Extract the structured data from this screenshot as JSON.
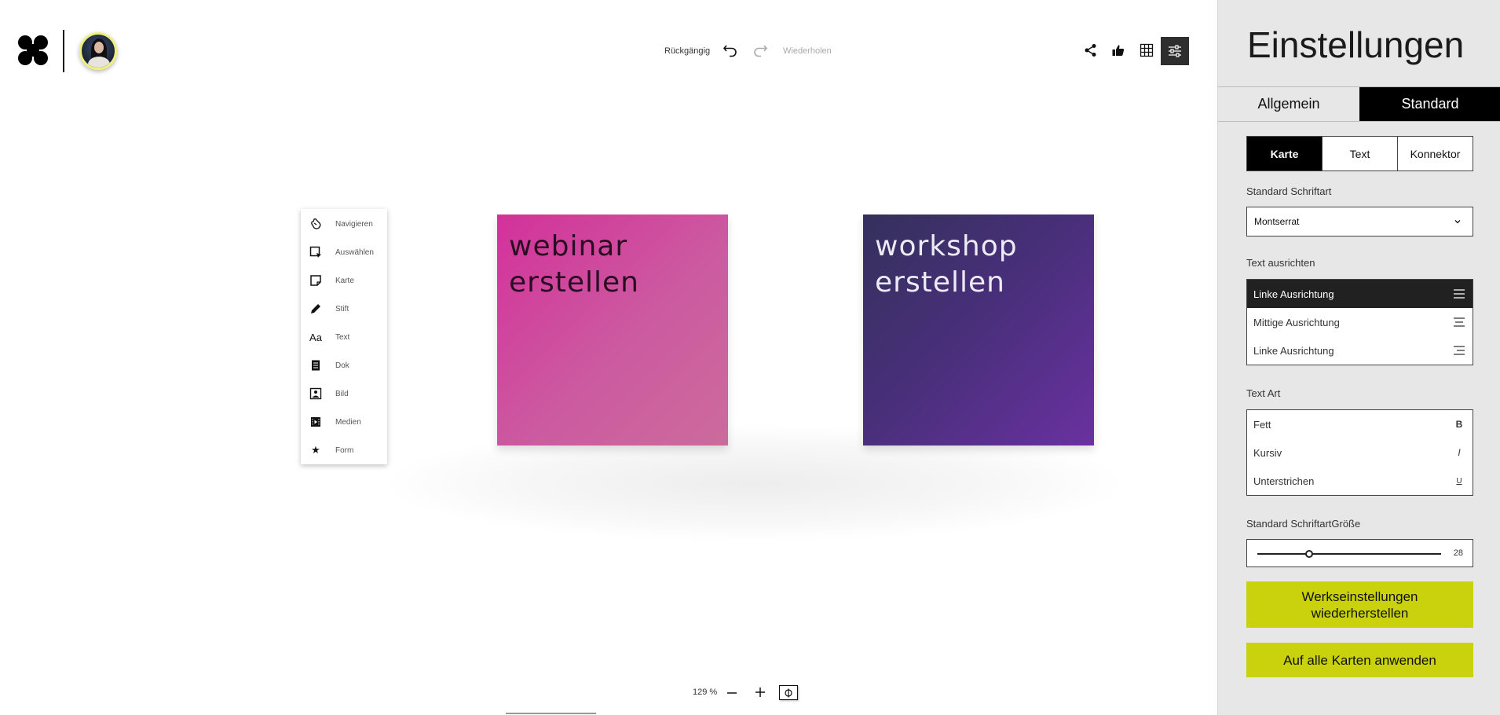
{
  "header": {
    "undo_label": "Rückgängig",
    "redo_label": "Wiederholen",
    "actions": [
      {
        "name": "share-icon"
      },
      {
        "name": "thumbs-up-icon"
      },
      {
        "name": "grid-icon"
      },
      {
        "name": "settings-sliders-icon"
      }
    ]
  },
  "toolbox": {
    "items": [
      {
        "label": "Navigieren",
        "icon": "navigate-hand-icon"
      },
      {
        "label": "Auswählen",
        "icon": "select-icon"
      },
      {
        "label": "Karte",
        "icon": "card-icon"
      },
      {
        "label": "Stift",
        "icon": "pen-icon"
      },
      {
        "label": "Text",
        "icon": "text-icon",
        "glyph": "Aa"
      },
      {
        "label": "Dok",
        "icon": "document-icon"
      },
      {
        "label": "Bild",
        "icon": "image-icon"
      },
      {
        "label": "Medien",
        "icon": "media-icon"
      },
      {
        "label": "Form",
        "icon": "star-shape-icon",
        "glyph": "★"
      }
    ]
  },
  "board": {
    "notes": [
      {
        "line1": "webinar",
        "line2": "erstellen",
        "color": "#d3319a"
      },
      {
        "line1": "workshop",
        "line2": "erstellen",
        "color": "#4a2f7c"
      }
    ]
  },
  "zoom": {
    "value": "129 %"
  },
  "settings": {
    "title": "Einstellungen",
    "main_tabs": [
      {
        "label": "Allgemein",
        "active": false
      },
      {
        "label": "Standard",
        "active": true
      }
    ],
    "sub_tabs": [
      {
        "label": "Karte",
        "active": true
      },
      {
        "label": "Text",
        "active": false
      },
      {
        "label": "Konnektor",
        "active": false
      }
    ],
    "font_label": "Standard Schriftart",
    "font_value": "Montserrat",
    "align_label": "Text ausrichten",
    "align_options": [
      {
        "label": "Linke Ausrichtung",
        "active": true
      },
      {
        "label": "Mittige Ausrichtung",
        "active": false
      },
      {
        "label": "Linke Ausrichtung",
        "active": false
      }
    ],
    "style_label": "Text Art",
    "style_options": [
      {
        "label": "Fett",
        "glyph": "B"
      },
      {
        "label": "Kursiv",
        "glyph": "I"
      },
      {
        "label": "Unterstrichen",
        "glyph": "U"
      }
    ],
    "size_label": "Standard SchriftartGröße",
    "size_value": "28",
    "size_fraction": 0.28,
    "reset_button": "Werkseinstellungen wiederherstellen",
    "apply_button": "Auf alle Karten anwenden",
    "accent_color": "#c9d20c"
  }
}
